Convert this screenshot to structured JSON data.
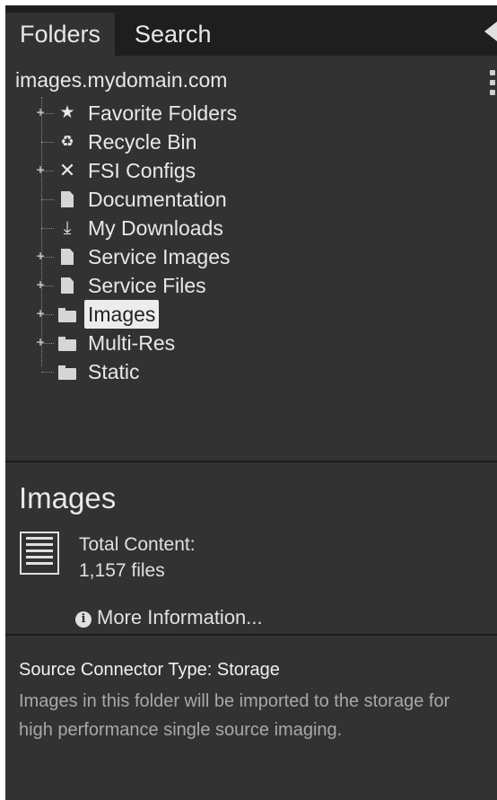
{
  "tabs": [
    {
      "label": "Folders",
      "active": true
    },
    {
      "label": "Search",
      "active": false
    }
  ],
  "tree": {
    "root": "images.mydomain.com",
    "items": [
      {
        "label": "Favorite Folders",
        "icon": "star-icon",
        "expandable": true
      },
      {
        "label": "Recycle Bin",
        "icon": "recycle-icon",
        "expandable": false
      },
      {
        "label": "FSI Configs",
        "icon": "tools-icon",
        "expandable": true
      },
      {
        "label": "Documentation",
        "icon": "document-icon",
        "expandable": false
      },
      {
        "label": "My Downloads",
        "icon": "download-icon",
        "expandable": false
      },
      {
        "label": "Service Images",
        "icon": "image-file-icon",
        "expandable": true
      },
      {
        "label": "Service Files",
        "icon": "service-file-icon",
        "expandable": true
      },
      {
        "label": "Images",
        "icon": "folder-icon",
        "expandable": true,
        "selected": true
      },
      {
        "label": "Multi-Res",
        "icon": "folder-icon",
        "expandable": true
      },
      {
        "label": "Static",
        "icon": "folder-icon",
        "expandable": false
      }
    ]
  },
  "info": {
    "title": "Images",
    "total_label": "Total Content:",
    "total_value": "1,157 files",
    "more_info": "More Information..."
  },
  "source": {
    "title": "Source Connector Type: Storage",
    "description": "Images in this folder will be imported to the storage for high performance single source imaging."
  },
  "colors": {
    "panel_bg": "#323232",
    "tabbar_bg": "#1e1e1e",
    "selected_bg": "#ececec"
  }
}
